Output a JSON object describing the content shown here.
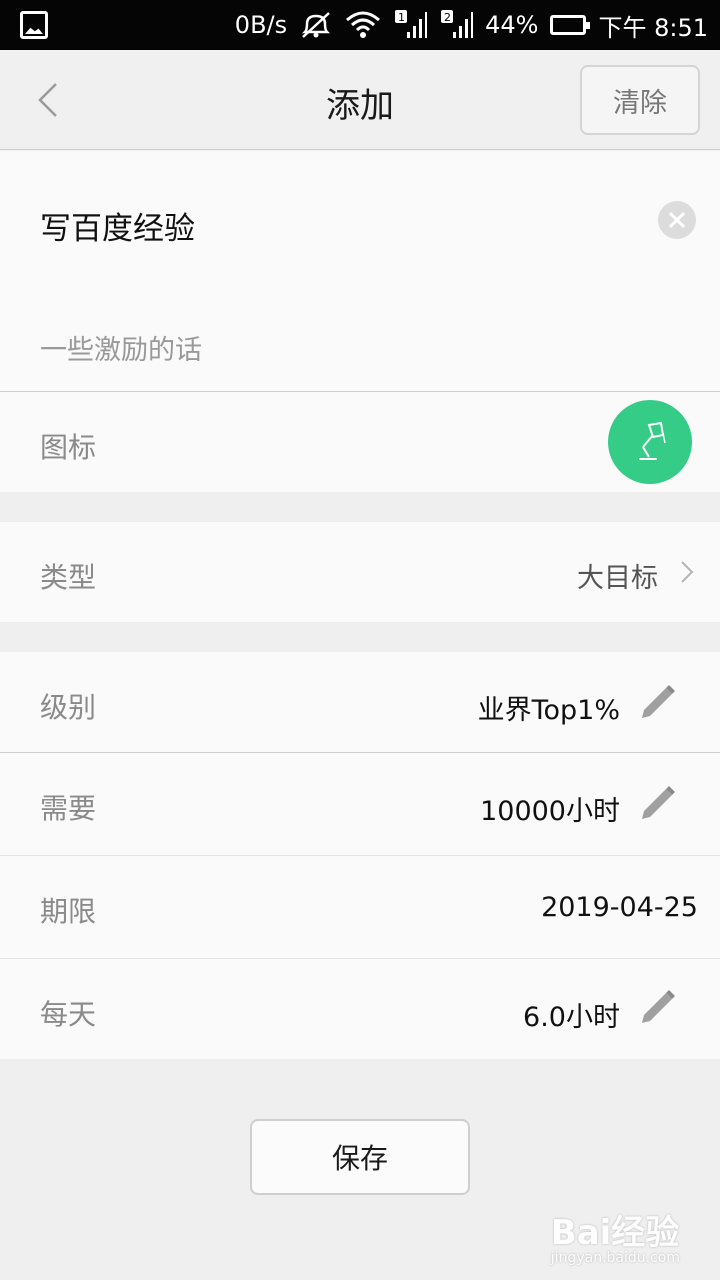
{
  "status_bar": {
    "net_speed": "0B/s",
    "sim1": "1",
    "sim2": "2",
    "battery": "44%",
    "time": "下午 8:51",
    "icons": [
      "gallery-icon",
      "mute-icon",
      "wifi-icon",
      "signal-icon",
      "battery-icon"
    ]
  },
  "header": {
    "title": "添加",
    "clear_label": "清除"
  },
  "goal": {
    "name": "写百度经验",
    "motivation_placeholder": "一些激励的话"
  },
  "icon_row": {
    "label": "图标",
    "accent": "#34cc87",
    "icon": "desk-lamp-icon"
  },
  "type_row": {
    "label": "类型",
    "value": "大目标"
  },
  "level_row": {
    "label": "级别",
    "value": "业界Top1%"
  },
  "need_row": {
    "label": "需要",
    "value": "10000小时"
  },
  "deadline_row": {
    "label": "期限",
    "value": "2019-04-25"
  },
  "daily_row": {
    "label": "每天",
    "value": "6.0小时"
  },
  "save_label": "保存",
  "watermark": {
    "brand": "Bai经验",
    "sub": "jingyan.baidu.com"
  }
}
